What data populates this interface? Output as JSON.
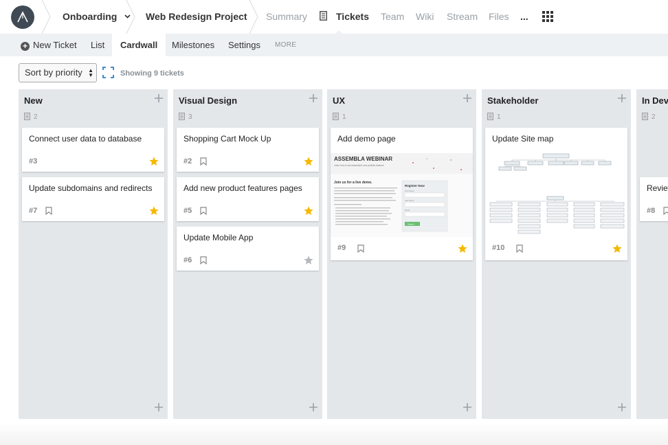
{
  "topnav": {
    "breadcrumb_space": "Onboarding",
    "breadcrumb_project": "Web Redesign Project",
    "links": {
      "summary": "Summary",
      "tickets": "Tickets",
      "team": "Team",
      "wiki": "Wiki",
      "stream": "Stream",
      "files": "Files",
      "more": "..."
    }
  },
  "subnav": {
    "new_ticket": "New Ticket",
    "list": "List",
    "cardwall": "Cardwall",
    "milestones": "Milestones",
    "settings": "Settings",
    "more": "MORE"
  },
  "toolbar": {
    "sort_value": "Sort by priority",
    "showing": "Showing 9 tickets"
  },
  "colors": {
    "accent_star": "#f5b800",
    "star_inactive": "#b5b9bd",
    "column_bg": "#e3e7ea",
    "subnav_bg": "#edf1f4"
  },
  "columns": [
    {
      "title": "New",
      "count": "2",
      "cards": [
        {
          "title": "Connect user data to database",
          "number": "#3",
          "starred": true
        },
        {
          "title": "Update subdomains and redirects",
          "number": "#7",
          "starred": true
        }
      ]
    },
    {
      "title": "Visual Design",
      "count": "3",
      "cards": [
        {
          "title": "Shopping Cart Mock Up",
          "number": "#2",
          "starred": true
        },
        {
          "title": "Add new product features pages",
          "number": "#5",
          "starred": true
        },
        {
          "title": "Update Mobile App",
          "number": "#6",
          "starred": false
        }
      ]
    },
    {
      "title": "UX",
      "count": "1",
      "cards": [
        {
          "title": "Add demo page",
          "number": "#9",
          "starred": true,
          "image": {
            "heading": "ASSEMBLA WEBINAR",
            "subheading": "Learn how to use Assembla's new portfolio features",
            "join": "Join us for a live demo.",
            "form_title": "Register Now",
            "form_fields": [
              "First Name",
              "Last Name",
              "Email"
            ],
            "form_button": "Register"
          }
        }
      ]
    },
    {
      "title": "Stakeholder",
      "count": "1",
      "cards": [
        {
          "title": "Update Site map",
          "number": "#10",
          "starred": true,
          "image": {
            "type": "sitemap"
          }
        }
      ]
    },
    {
      "title": "In Development",
      "count": "2",
      "cards": [
        {
          "title": "Review",
          "number": "#8",
          "starred": false
        }
      ]
    }
  ]
}
